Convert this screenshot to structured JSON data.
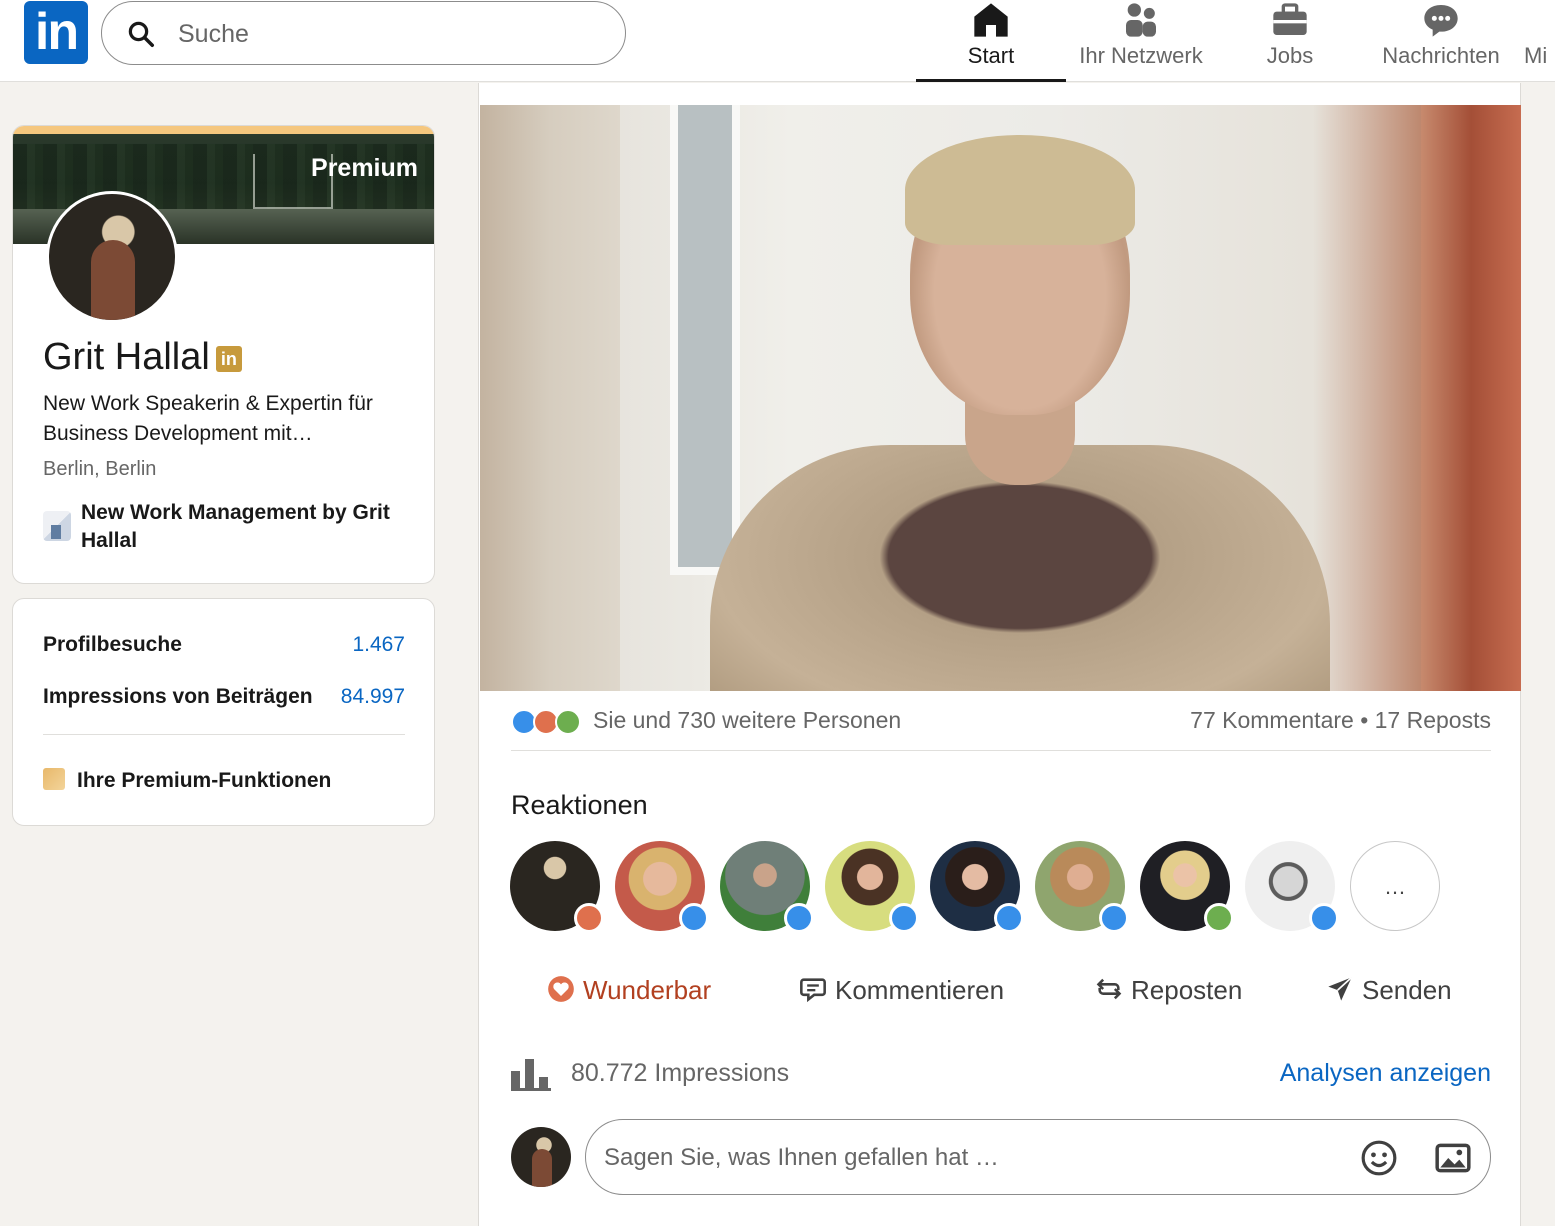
{
  "nav": {
    "search_placeholder": "Suche",
    "items": [
      {
        "label": "Start",
        "icon": "home-icon",
        "active": true
      },
      {
        "label": "Ihr Netzwerk",
        "icon": "network-icon"
      },
      {
        "label": "Jobs",
        "icon": "briefcase-icon"
      },
      {
        "label": "Nachrichten",
        "icon": "messaging-icon"
      },
      {
        "label": "Mi",
        "icon": "notifications-icon"
      }
    ]
  },
  "profile": {
    "banner_label": "Premium",
    "name": "Grit Hallal",
    "badge": "in",
    "headline": "New Work Speakerin & Expertin für Business Development mit…",
    "location": "Berlin, Berlin",
    "company": "New Work Management by Grit Hallal"
  },
  "stats": {
    "profile_visits_label": "Profilbesuche",
    "profile_visits_value": "1.467",
    "impressions_label": "Impressions von Beiträgen",
    "impressions_value": "84.997",
    "premium_features": "Ihre Premium-Funktionen"
  },
  "post": {
    "reactions_summary": "Sie und 730 weitere Personen",
    "comments_reposts": "77 Kommentare • 17 Reposts",
    "reactions_title": "Reaktionen",
    "reactors": [
      {
        "badge": "love"
      },
      {
        "badge": "like"
      },
      {
        "badge": "like"
      },
      {
        "badge": "like"
      },
      {
        "badge": "like"
      },
      {
        "badge": "like"
      },
      {
        "badge": "support"
      },
      {
        "badge": "like"
      }
    ],
    "more_label": "…",
    "actions": {
      "react": "Wunderbar",
      "comment": "Kommentieren",
      "repost": "Reposten",
      "send": "Senden"
    },
    "impressions": "80.772 Impressions",
    "analytics_link": "Analysen anzeigen",
    "comment_placeholder": "Sagen Sie, was Ihnen gefallen hat …"
  },
  "colors": {
    "brand": "#0a66c2",
    "love": "#df704d",
    "like": "#378fe9",
    "support": "#6dae4f"
  }
}
